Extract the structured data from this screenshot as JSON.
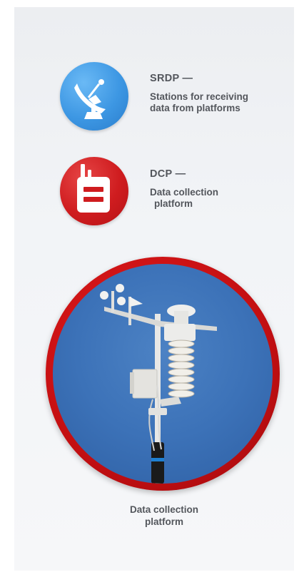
{
  "legend": {
    "srdp": {
      "abbr": "SRDP —",
      "desc_line1": "Stations for receiving",
      "desc_line2": "data from platforms",
      "icon": "satellite-dish-icon",
      "color": "#3d97e3"
    },
    "dcp": {
      "abbr": "DCP —",
      "desc_line1": "Data collection",
      "desc_line2": "platform",
      "icon": "radio-transmitter-icon",
      "color": "#cf1c1f"
    }
  },
  "photo": {
    "subject": "weather station mast against blue sky",
    "ring_color": "#c30f12",
    "caption_line1": "Data collection",
    "caption_line2": "platform"
  }
}
